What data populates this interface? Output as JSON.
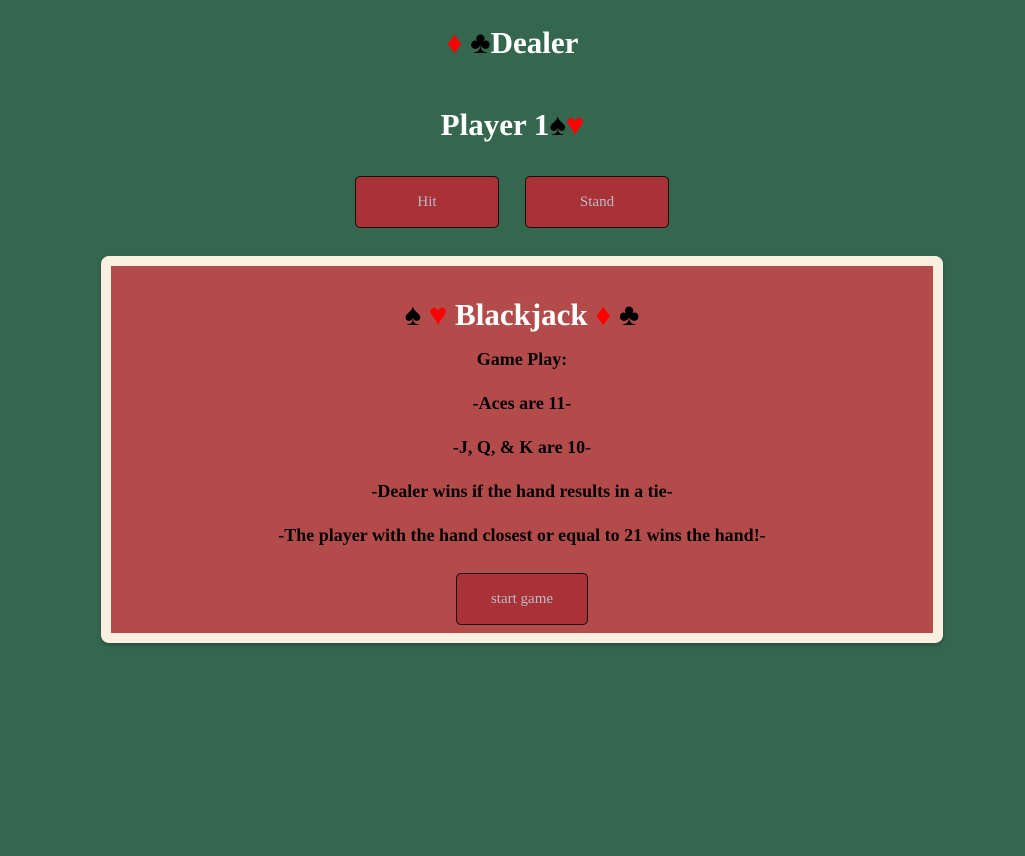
{
  "dealer": {
    "suit_diamond": "♦",
    "suit_club": "♣",
    "label": "Dealer"
  },
  "player": {
    "label": "Player 1",
    "suit_spade": "♠",
    "suit_heart": "♥"
  },
  "controls": {
    "hit_label": "Hit",
    "stand_label": "Stand"
  },
  "rules_panel": {
    "title": "Blackjack",
    "title_suits": {
      "spade": "♠",
      "heart": "♥",
      "diamond": "♦",
      "club": "♣"
    },
    "lines": [
      "Game Play:",
      "-Aces are 11-",
      "-J, Q, & K are 10-",
      "-Dealer wins if the hand results in a tie-",
      "-The player with the hand closest or equal to 21 wins the hand!-"
    ],
    "start_label": "start game"
  },
  "colors": {
    "table_background": "#35674f",
    "panel_background": "#b34b4b",
    "panel_border": "#fbefe0",
    "button_background": "#a83236",
    "button_text": "#b9b9c8",
    "red_suit": "#ff0000",
    "black_suit": "#000000"
  }
}
